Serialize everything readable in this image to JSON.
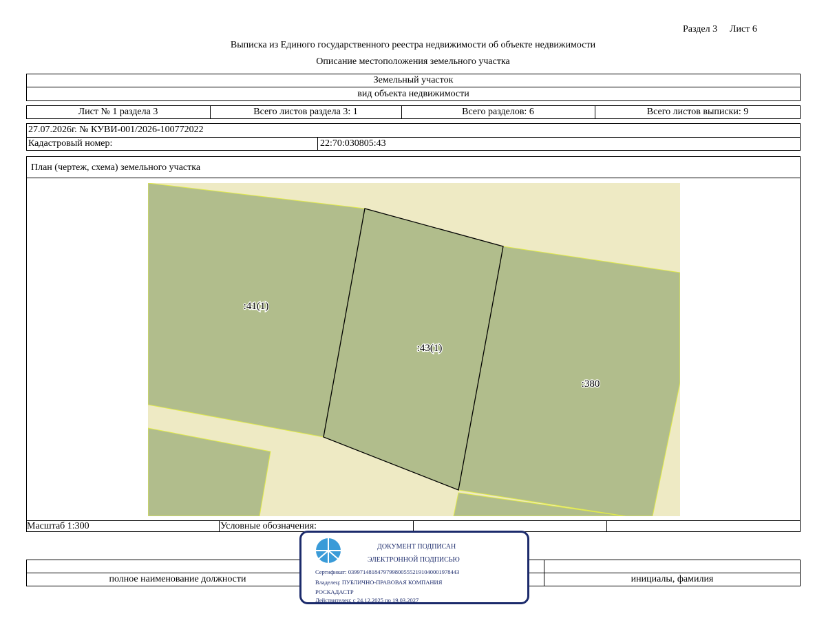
{
  "header": {
    "section": "Раздел 3",
    "sheet": "Лист 6",
    "title": "Выписка из Единого государственного реестра недвижимости об объекте недвижимости",
    "subtitle": "Описание местоположения земельного участка"
  },
  "object": {
    "name": "Земельный участок",
    "kind_label": "вид объекта недвижимости"
  },
  "sheets_row": {
    "sheet_no": "Лист № 1 раздела 3",
    "total_sheets_section": "Всего листов раздела 3: 1",
    "total_sections": "Всего разделов: 6",
    "total_sheets_extract": "Всего листов выписки: 9"
  },
  "info": {
    "date_number": "27.07.2026г. № КУВИ-001/2026-100772022",
    "cadastral_label": "Кадастровый номер:",
    "cadastral_value": "22:70:030805:43"
  },
  "plan": {
    "title": "План (чертеж, схема) земельного участка",
    "labels": [
      ":41(1)",
      ":43(1)",
      ":380"
    ],
    "colors": {
      "parcel": "#b1bd8c",
      "background": "#eeeac4",
      "border": "#000000",
      "yellow_border": "#e1ea4a"
    }
  },
  "footer": {
    "scale": "Масштаб 1:300",
    "legend": "Условные обозначения:",
    "position_label": "полное наименование должности",
    "initials_label": "инициалы, фамилия"
  },
  "stamp": {
    "line1": "ДОКУМЕНТ ПОДПИСАН",
    "line2": "ЭЛЕКТРОННОЙ ПОДПИСЬЮ",
    "certificate": "Сертификат: 0399714818479799800555219104000197844З",
    "owner": "Владелец: ПУБЛИЧНО-ПРАВОВАЯ КОМПАНИЯ",
    "owner2": "РОСКАДАСТР",
    "valid": "Действителен: с 24.12.2025 по 19.03.2027",
    "color": "#1b2a6b",
    "logo_color": "#3a9bd8"
  }
}
